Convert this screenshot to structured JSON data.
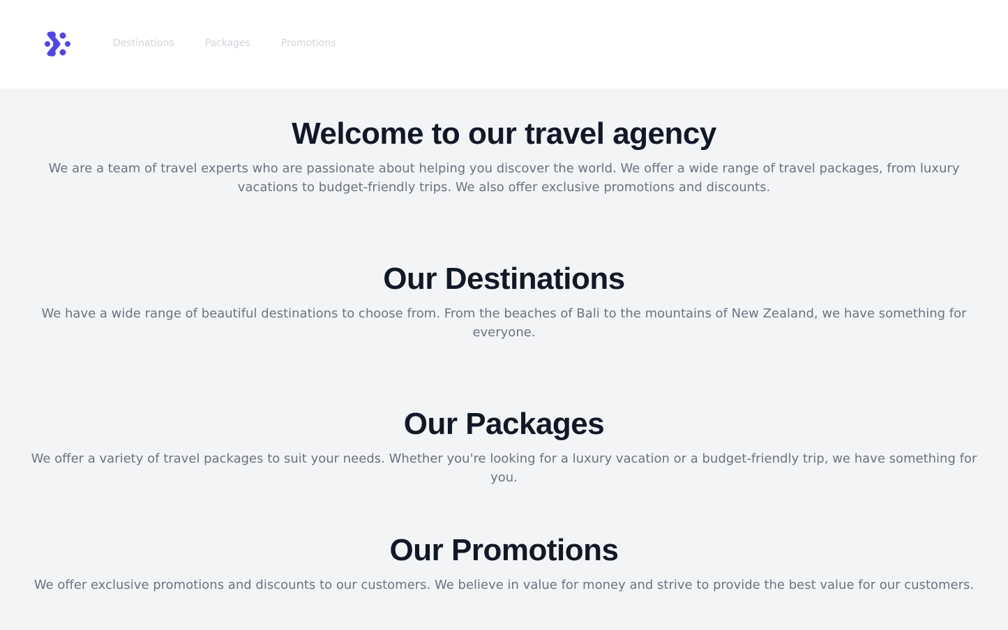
{
  "brand": {
    "accent": "#4f46e5"
  },
  "nav": {
    "items": [
      {
        "label": "Destinations"
      },
      {
        "label": "Packages"
      },
      {
        "label": "Promotions"
      }
    ]
  },
  "hero": {
    "title": "Welcome to our travel agency",
    "text": "We are a team of travel experts who are passionate about helping you discover the world. We offer a wide range of travel packages, from luxury vacations to budget-friendly trips. We also offer exclusive promotions and discounts."
  },
  "destinations": {
    "title": "Our Destinations",
    "text": "We have a wide range of beautiful destinations to choose from. From the beaches of Bali to the mountains of New Zealand, we have something for everyone."
  },
  "packages": {
    "title": "Our Packages",
    "text": "We offer a variety of travel packages to suit your needs. Whether you're looking for a luxury vacation or a budget-friendly trip, we have something for you."
  },
  "promotions": {
    "title": "Our Promotions",
    "text": "We offer exclusive promotions and discounts to our customers. We believe in value for money and strive to provide the best value for our customers."
  }
}
